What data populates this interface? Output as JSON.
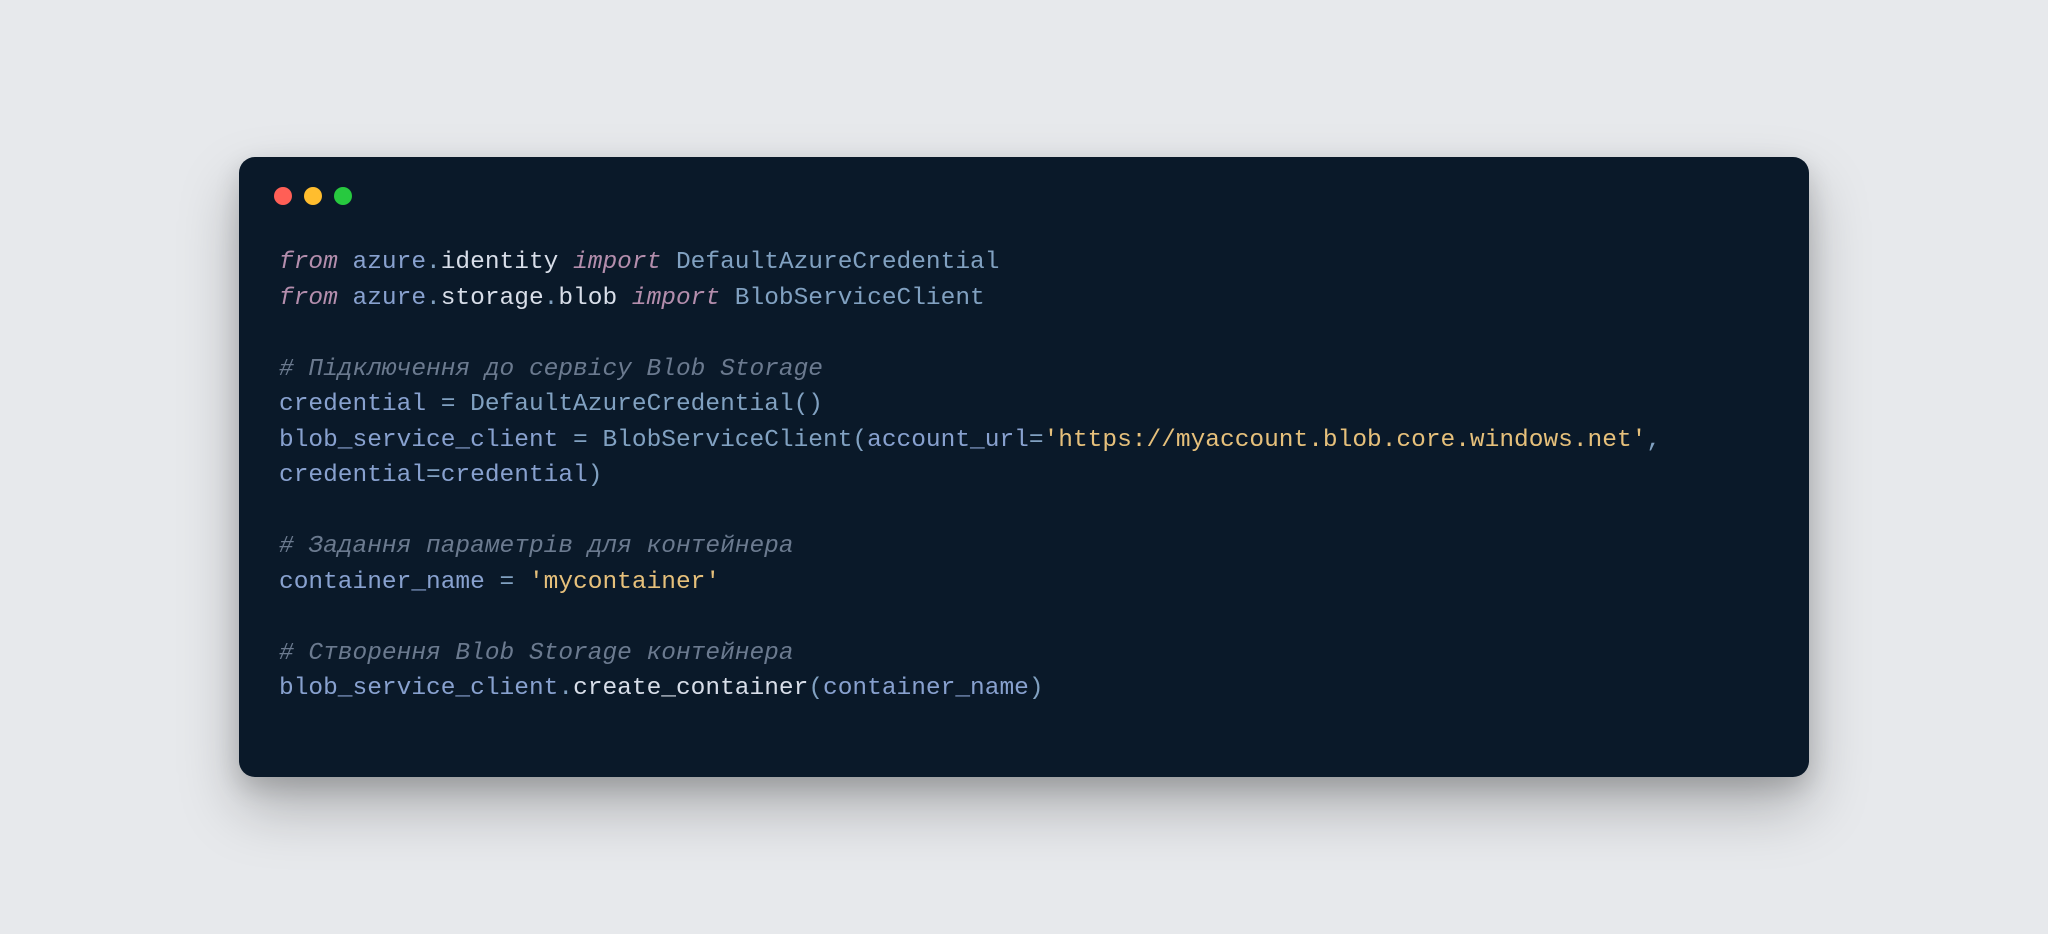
{
  "code": {
    "l1": {
      "from": "from",
      "mod1": "azure",
      "dot1": ".",
      "mod2": "identity",
      "imp": "import",
      "name": "DefaultAzureCredential"
    },
    "l2": {
      "from": "from",
      "mod1": "azure",
      "dot1": ".",
      "mod2": "storage",
      "dot2": ".",
      "mod3": "blob",
      "imp": "import",
      "name": "BlobServiceClient"
    },
    "c1": "# Підключення до сервісу Blob Storage",
    "l3": {
      "lhs": "credential",
      "eq": " = ",
      "fn": "DefaultAzureCredential",
      "paren": "()"
    },
    "l4": {
      "lhs": "blob_service_client",
      "eq": " = ",
      "fn": "BlobServiceClient",
      "lp": "(",
      "kw1": "account_url",
      "eq1": "=",
      "str1": "'https://myaccount.blob.core.windows.net'",
      "comma": ", ",
      "kw2": "credential",
      "eq2": "=",
      "val2": "credential",
      "rp": ")"
    },
    "c2": "# Задання параметрів для контейнера",
    "l5": {
      "lhs": "container_name",
      "eq": " = ",
      "str": "'mycontainer'"
    },
    "c3": "# Створення Blob Storage контейнера",
    "l6": {
      "obj": "blob_service_client",
      "dot": ".",
      "fn": "create_container",
      "lp": "(",
      "arg": "container_name",
      "rp": ")"
    }
  }
}
